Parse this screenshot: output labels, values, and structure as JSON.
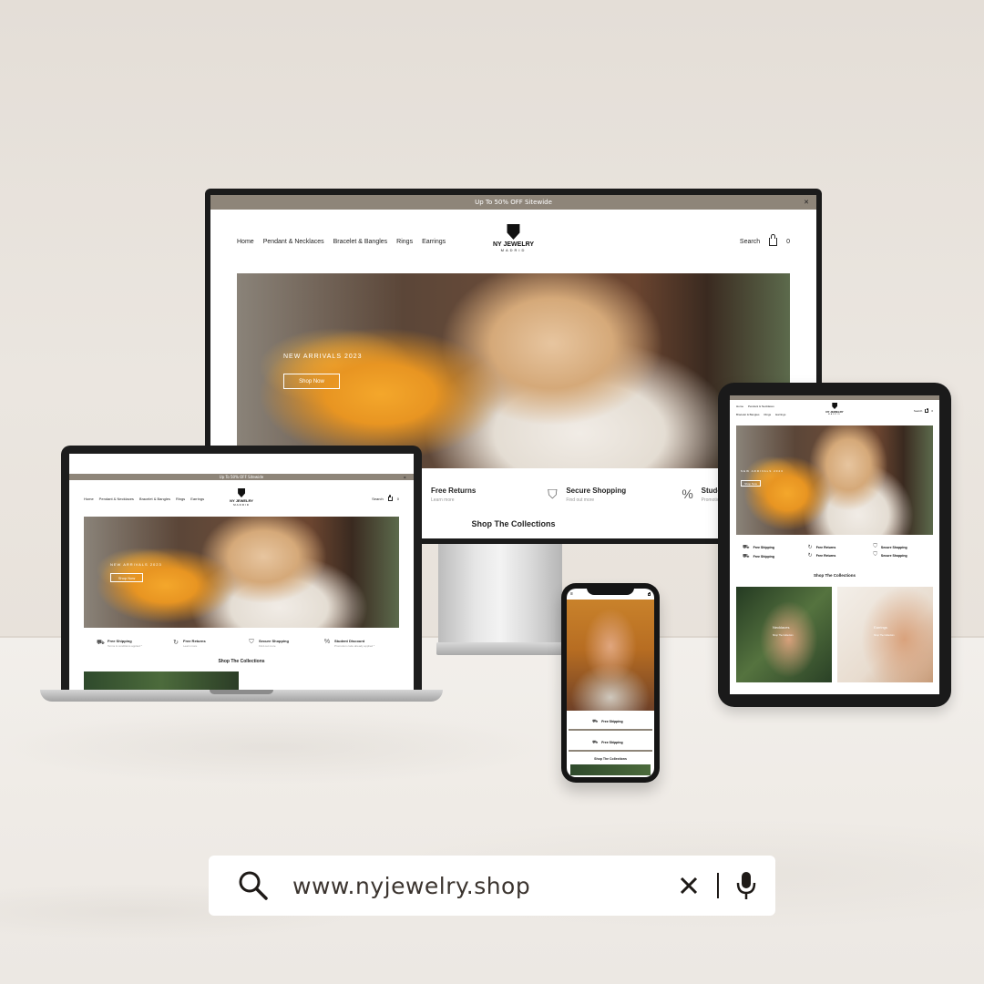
{
  "site": {
    "announcement": "Up To 50% OFF Sitewide",
    "close": "✕",
    "nav": [
      "Home",
      "Pendant & Necklaces",
      "Bracelet & Bangles",
      "Rings",
      "Earrings"
    ],
    "brand_name": "NY JEWELRY",
    "brand_sub": "MADRID",
    "search_label": "Search",
    "cart_count": "0",
    "hero_kicker": "NEW ARRIVALS 2023",
    "hero_button": "Shop Now",
    "features": [
      {
        "title": "Free Shipping",
        "desc": "Terms & conditions applied *"
      },
      {
        "title": "Free Returns",
        "desc": "Learn more"
      },
      {
        "title": "Secure Shopping",
        "desc": "Find out more"
      },
      {
        "title": "Student Discount",
        "desc": "Promotion code already applied *"
      }
    ],
    "collections_title": "Shop The Collections",
    "collections": [
      {
        "name": "Necklaces",
        "cta": "Shop The Collection"
      },
      {
        "name": "Earrings",
        "cta": "Shop The Collection"
      }
    ]
  },
  "tablet_nav_row1": [
    "Home",
    "Pendant & Necklaces"
  ],
  "tablet_nav_row2": [
    "Bracelet & Bangles",
    "Rings",
    "Earrings"
  ],
  "tablet_features": [
    [
      "Free Shipping",
      "Free Shipping"
    ],
    [
      "Free Returns",
      "Free Returns"
    ],
    [
      "Secure Shopping",
      "Secure Shopping"
    ]
  ],
  "search": {
    "url": "www.nyjewelry.shop",
    "icons": [
      "search-icon",
      "clear-icon",
      "microphone-icon"
    ]
  }
}
